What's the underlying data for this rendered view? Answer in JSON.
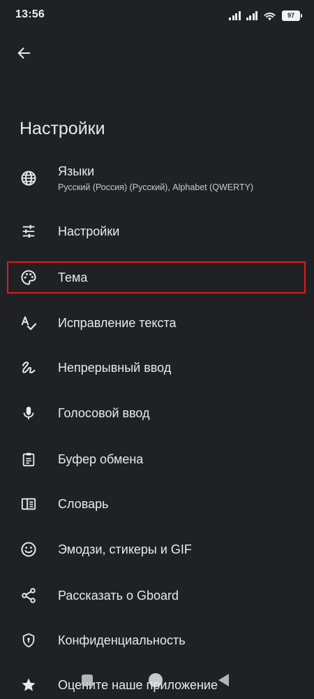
{
  "status_bar": {
    "time": "13:56",
    "battery": "97",
    "icons": [
      "signal-icon",
      "signal-icon",
      "wifi-icon",
      "battery-icon"
    ]
  },
  "header": {
    "back_icon": "arrow-back-icon",
    "title": "Настройки"
  },
  "menu": {
    "items": [
      {
        "icon": "globe-icon",
        "label": "Языки",
        "sublabel": "Русский (Россия) (Русский), Alphabet (QWERTY)"
      },
      {
        "icon": "sliders-icon",
        "label": "Настройки"
      },
      {
        "icon": "palette-icon",
        "label": "Тема"
      },
      {
        "icon": "spellcheck-icon",
        "label": "Исправление текста"
      },
      {
        "icon": "gesture-icon",
        "label": "Непрерывный ввод"
      },
      {
        "icon": "microphone-icon",
        "label": "Голосовой ввод"
      },
      {
        "icon": "clipboard-icon",
        "label": "Буфер обмена"
      },
      {
        "icon": "dictionary-icon",
        "label": "Словарь"
      },
      {
        "icon": "emoji-icon",
        "label": "Эмодзи, стикеры и GIF"
      },
      {
        "icon": "share-icon",
        "label": "Рассказать о Gboard"
      },
      {
        "icon": "shield-icon",
        "label": "Конфиденциальность"
      },
      {
        "icon": "star-icon",
        "label": "Оцените наше приложение"
      }
    ]
  },
  "highlighted_item": "Тема",
  "colors": {
    "background": "#202124",
    "text": "#e8eaed",
    "highlight_border": "#e01b1b"
  },
  "nav_bar": {
    "icons": [
      "recent-apps-icon",
      "home-icon",
      "back-triangle-icon"
    ]
  }
}
